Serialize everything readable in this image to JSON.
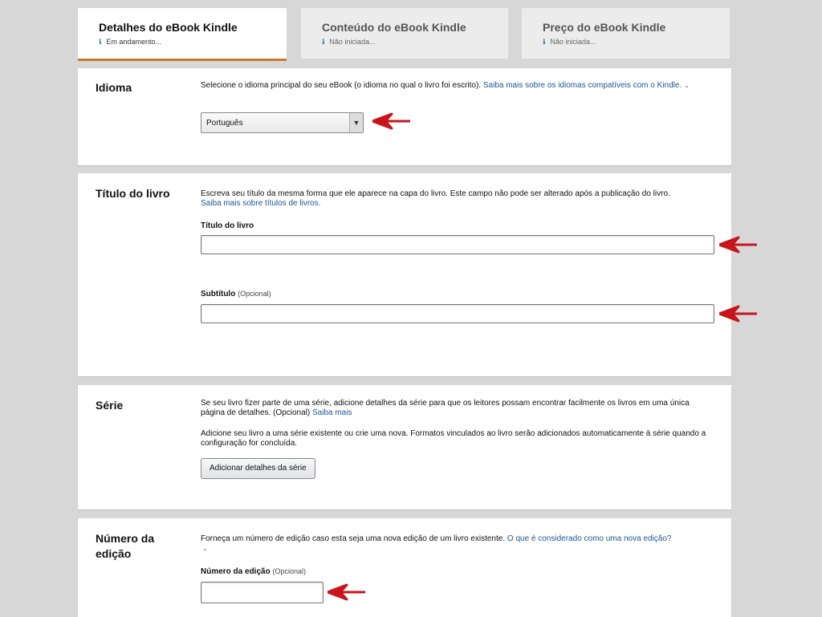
{
  "tabs": [
    {
      "title": "Detalhes do eBook Kindle",
      "status": "Em andamento...",
      "active": true
    },
    {
      "title": "Conteúdo do eBook Kindle",
      "status": "Não iniciada...",
      "active": false
    },
    {
      "title": "Preço do eBook Kindle",
      "status": "Não iniciada...",
      "active": false
    }
  ],
  "info_icon": "info-icon",
  "language": {
    "title": "Idioma",
    "description": "Selecione o idioma principal do seu eBook (o idioma no qual o livro foi escrito).",
    "link": "Saiba mais sobre os idiomas compatíveis com o Kindle.",
    "selected": "Português"
  },
  "book_title": {
    "title": "Título do livro",
    "description": "Escreva seu título da mesma forma que ele aparece na capa do livro. Este campo não pode ser alterado após a publicação do livro.",
    "link": "Saiba mais sobre títulos de livros.",
    "title_label": "Título do livro",
    "title_value": "",
    "subtitle_label": "Subtítulo",
    "subtitle_optional": "(Opcional)",
    "subtitle_value": ""
  },
  "series": {
    "title": "Série",
    "description": "Se seu livro fizer parte de uma série, adicione detalhes da série para que os leitores possam encontrar facilmente os livros em uma única página de detalhes. (Opcional)",
    "link": "Saiba mais",
    "description2": "Adicione seu livro a uma série existente ou crie uma nova. Formatos vinculados ao livro serão adicionados automaticamente à série quando a configuração for concluída.",
    "button": "Adicionar detalhes da série"
  },
  "edition": {
    "title": "Número da edição",
    "description": "Forneça um número de edição caso esta seja uma nova edição de um livro existente.",
    "link": "O que é considerado como uma nova edição?",
    "label": "Número da edição",
    "optional": "(Opcional)",
    "value": ""
  },
  "colors": {
    "accent": "#c7792a",
    "link": "#1d5694",
    "arrow": "#c8151b"
  }
}
